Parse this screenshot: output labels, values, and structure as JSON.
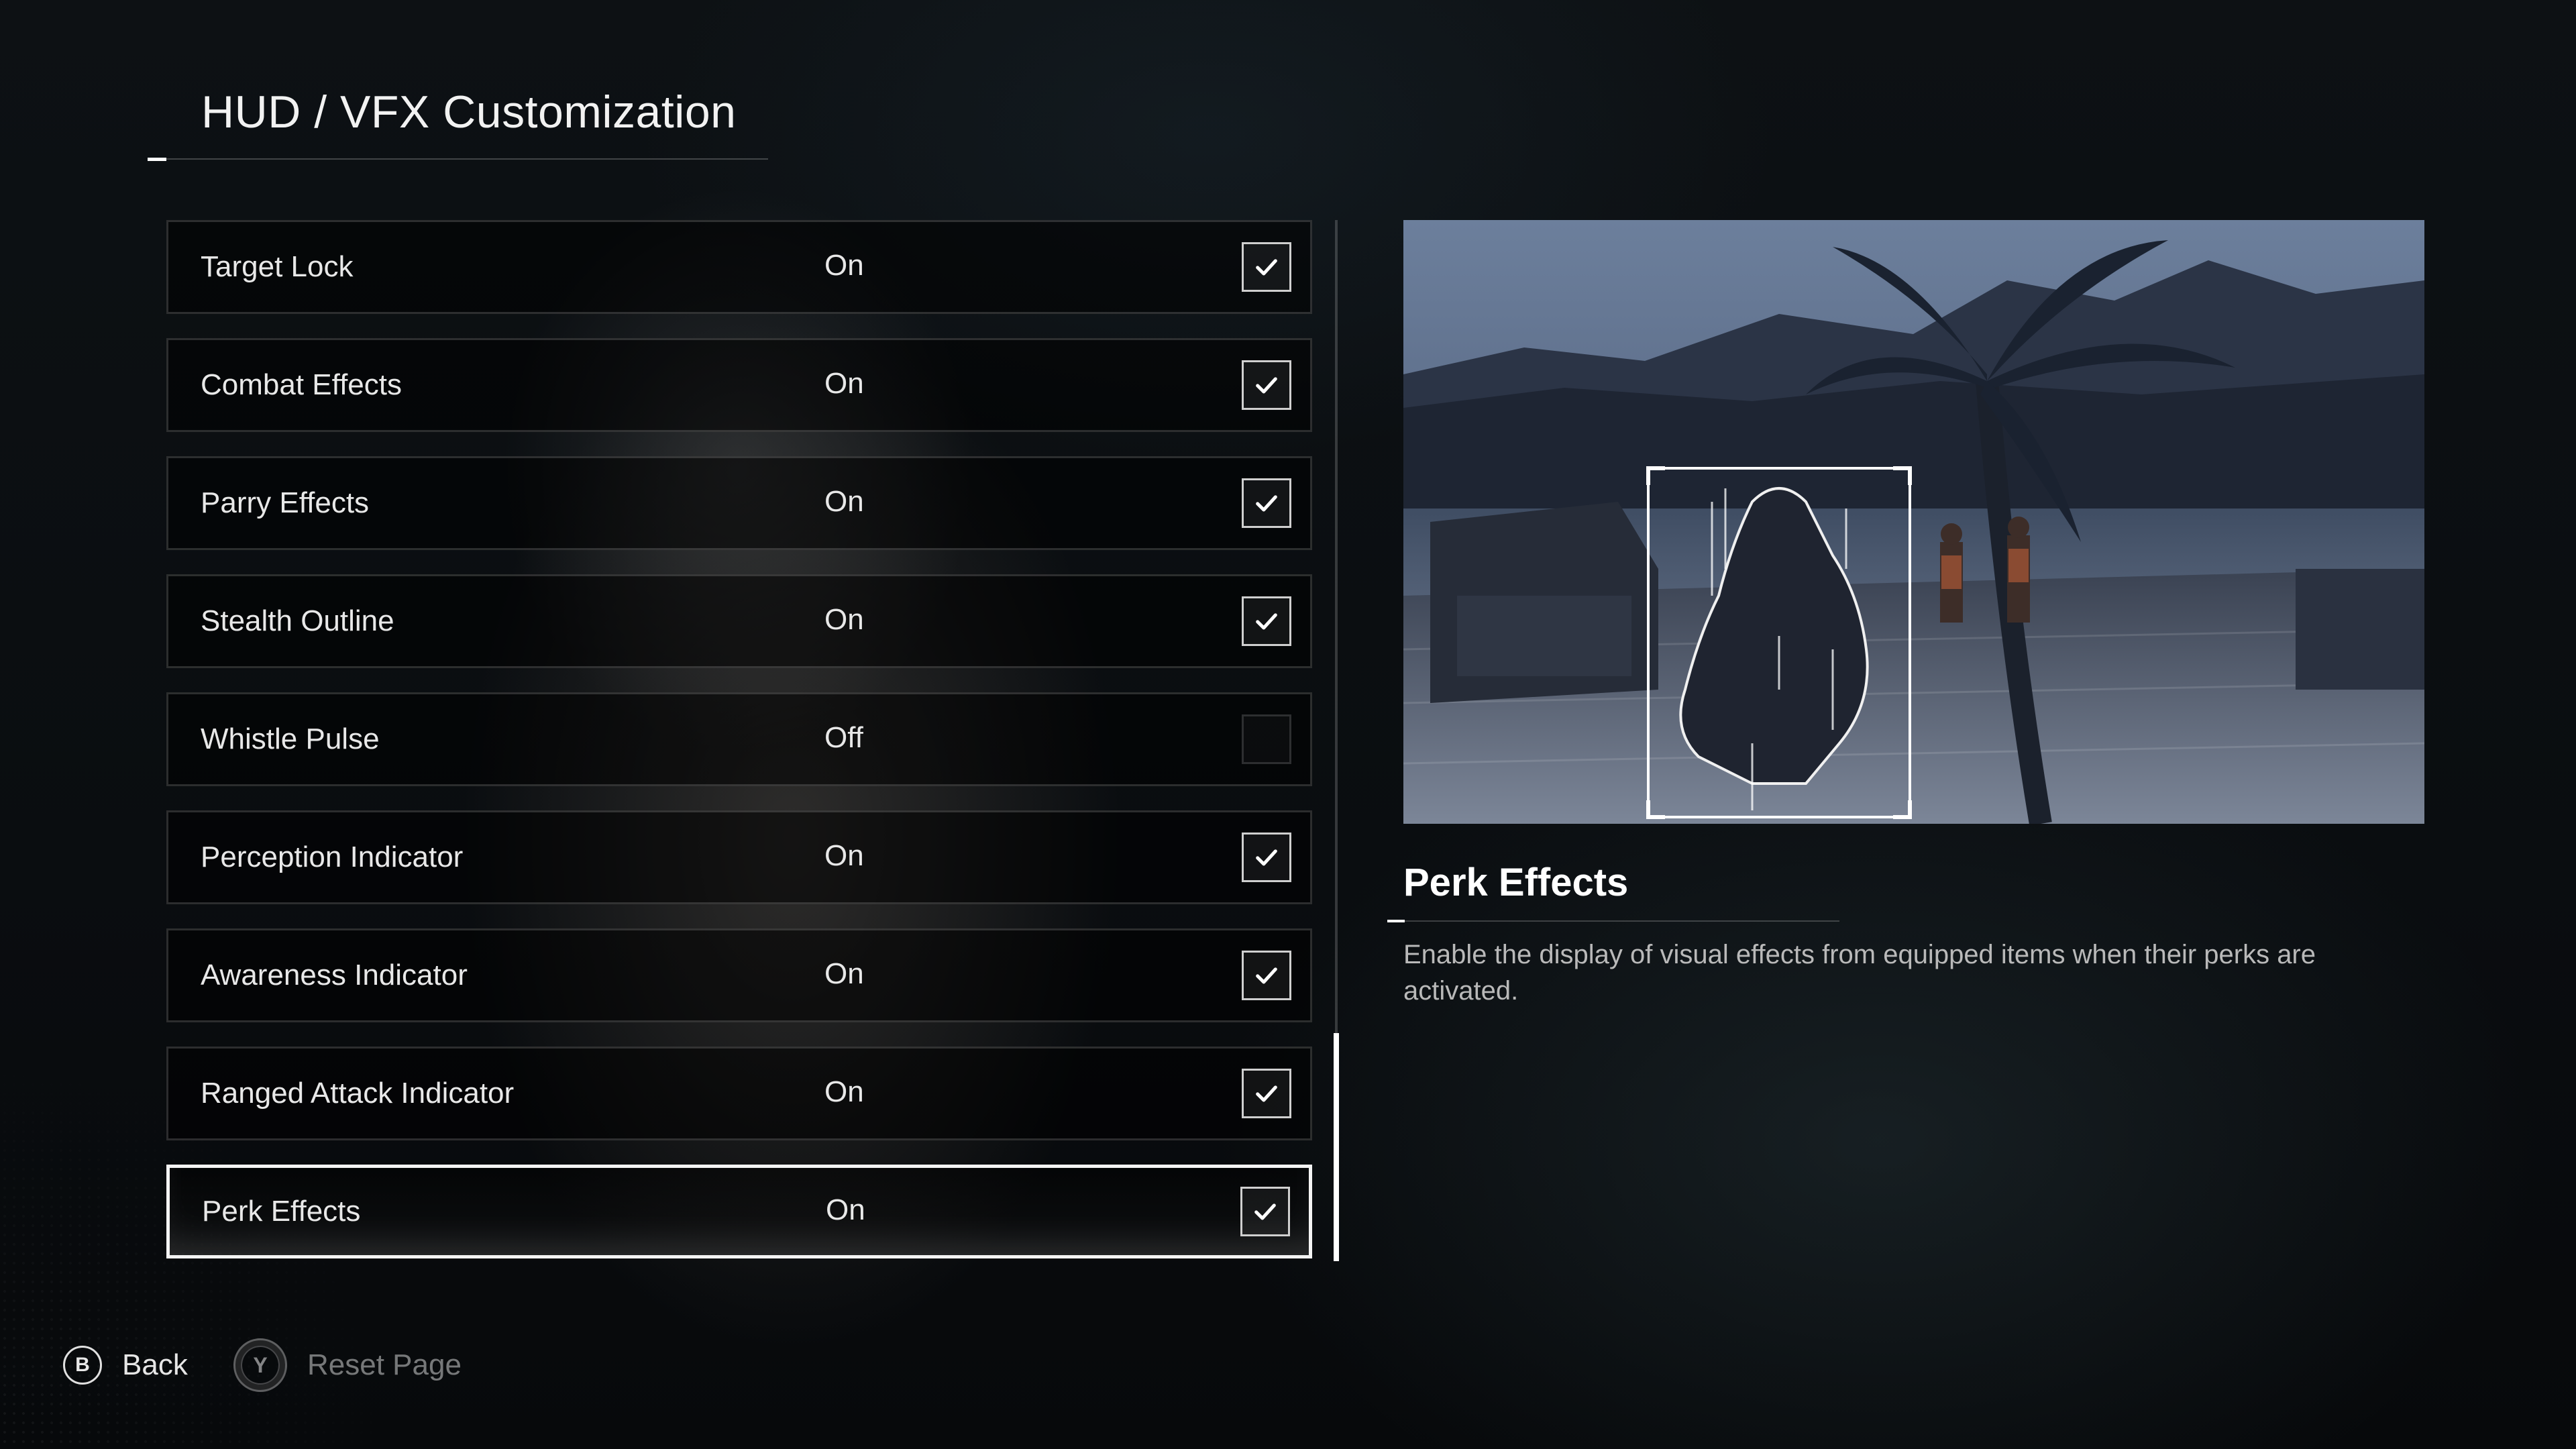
{
  "page": {
    "title": "HUD / VFX Customization"
  },
  "settings": [
    {
      "label": "Target Lock",
      "value": "On",
      "checked": true,
      "selected": false
    },
    {
      "label": "Combat Effects",
      "value": "On",
      "checked": true,
      "selected": false
    },
    {
      "label": "Parry Effects",
      "value": "On",
      "checked": true,
      "selected": false
    },
    {
      "label": "Stealth Outline",
      "value": "On",
      "checked": true,
      "selected": false
    },
    {
      "label": "Whistle Pulse",
      "value": "Off",
      "checked": false,
      "selected": false
    },
    {
      "label": "Perception Indicator",
      "value": "On",
      "checked": true,
      "selected": false
    },
    {
      "label": "Awareness Indicator",
      "value": "On",
      "checked": true,
      "selected": false
    },
    {
      "label": "Ranged Attack Indicator",
      "value": "On",
      "checked": true,
      "selected": false
    },
    {
      "label": "Perk Effects",
      "value": "On",
      "checked": true,
      "selected": true
    }
  ],
  "detail": {
    "title": "Perk Effects",
    "description": "Enable the display of visual effects from equipped items when their perks are activated.",
    "preview_image": "night-harbor-scene-with-highlighted-character"
  },
  "footer": {
    "back": {
      "button": "B",
      "label": "Back"
    },
    "reset": {
      "button": "Y",
      "label": "Reset Page"
    }
  },
  "colors": {
    "background": "#0b0f12",
    "text": "#e8e8e8",
    "selected_border": "#f4f4f4",
    "row_border": "rgba(255,255,255,0.16)",
    "muted_text": "#b9b9b9"
  }
}
